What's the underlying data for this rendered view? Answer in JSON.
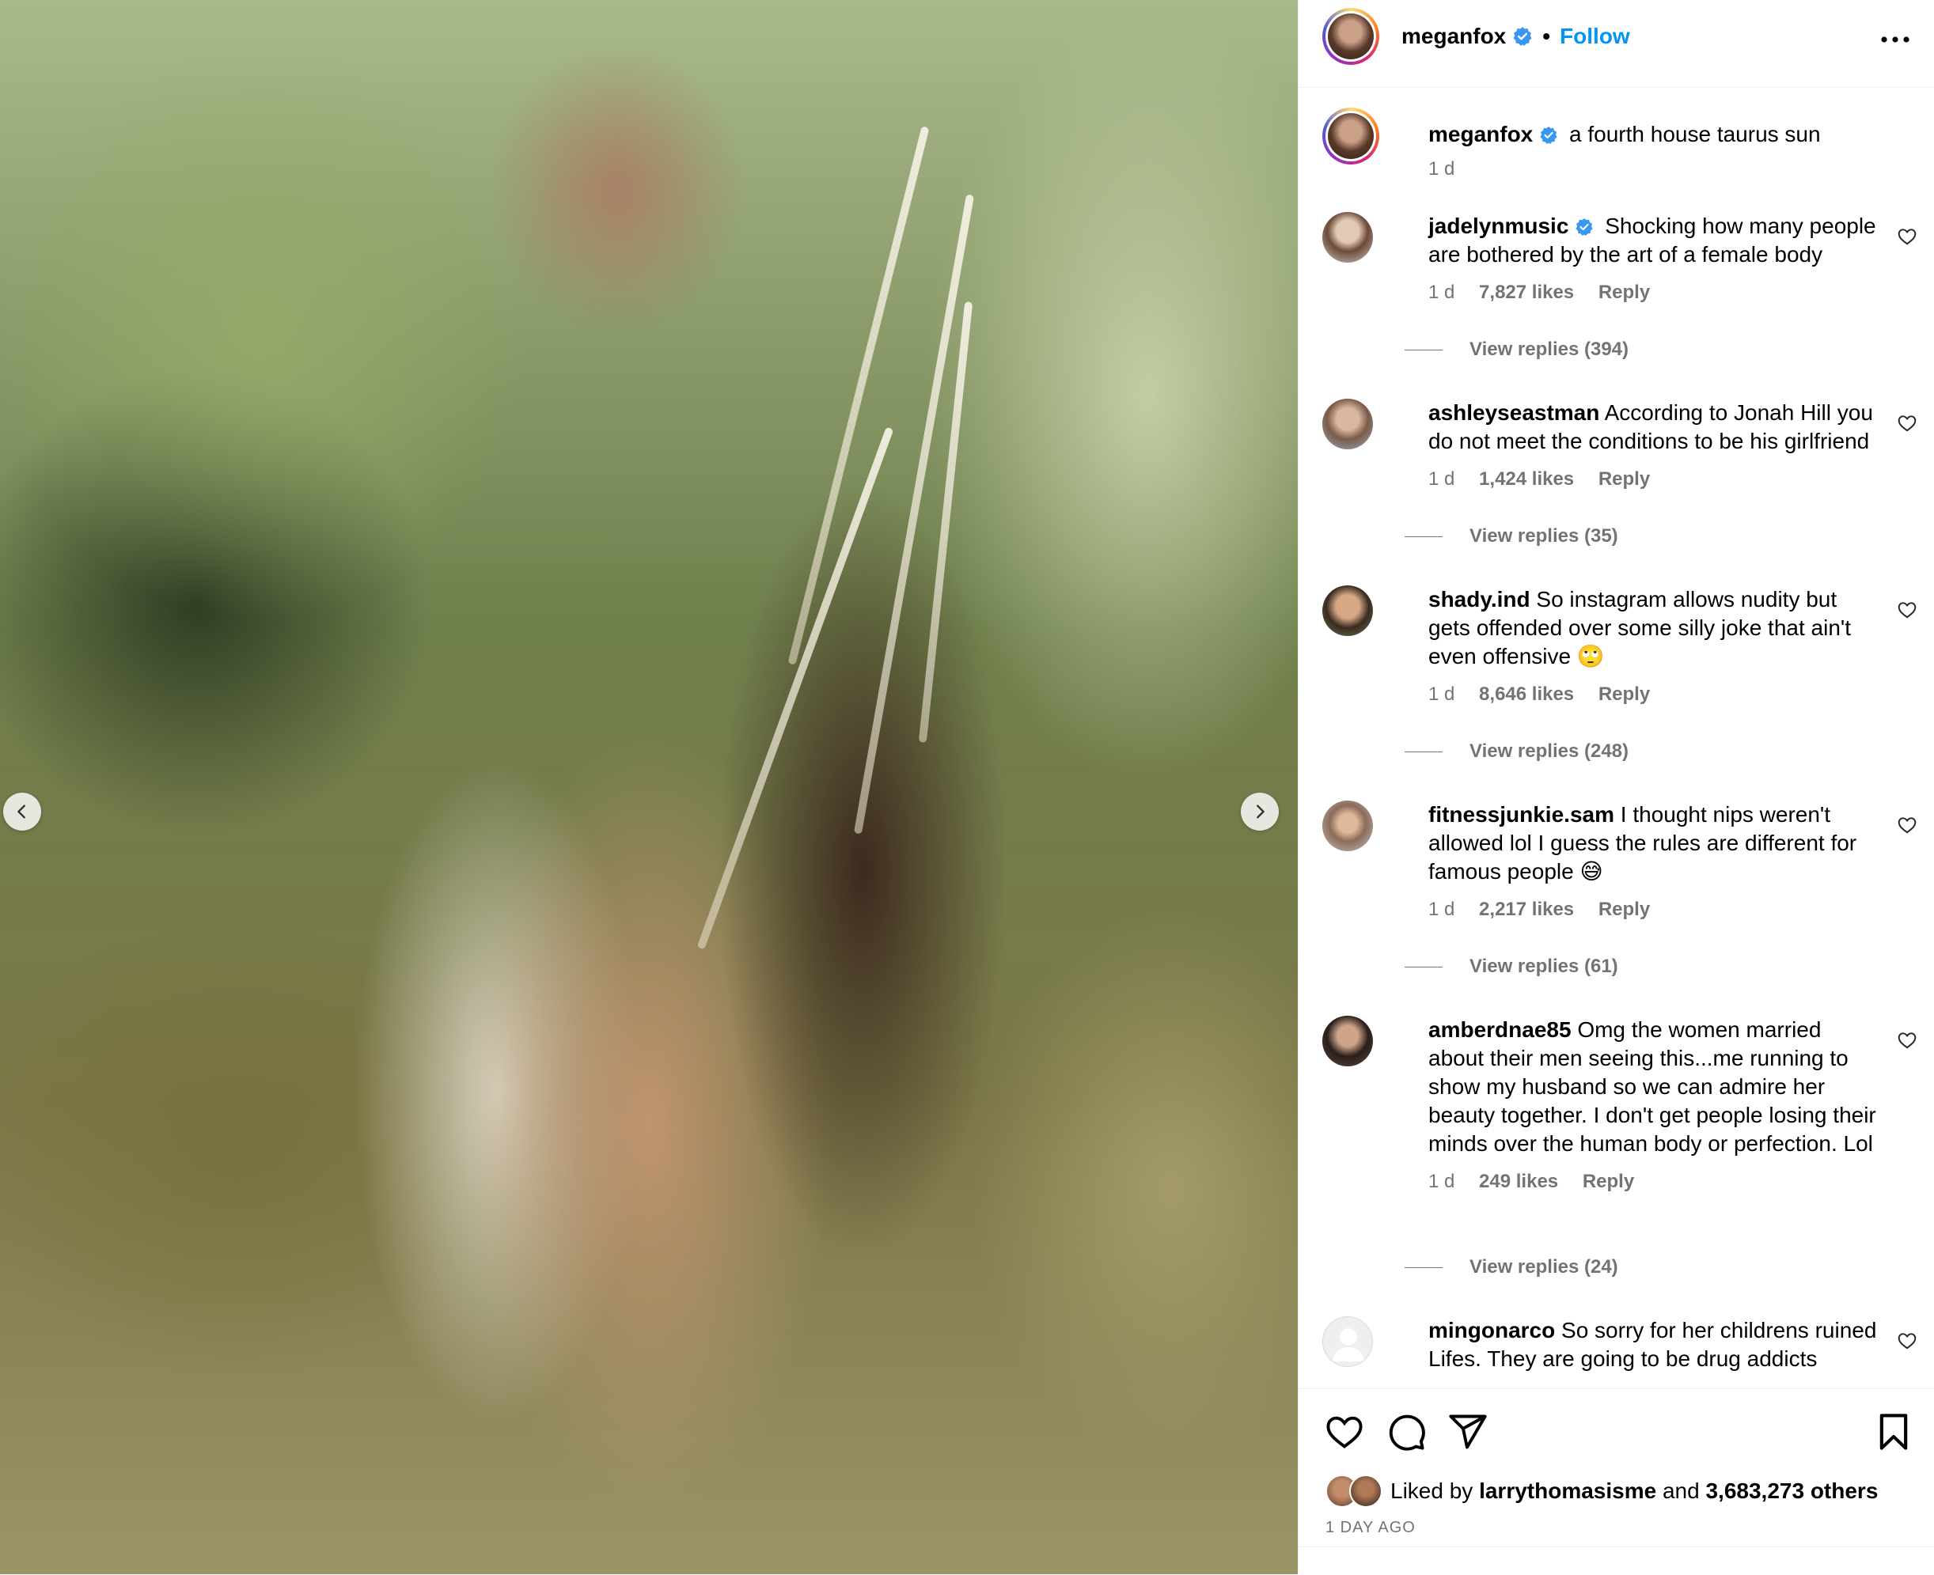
{
  "colors": {
    "accent": "#0095f6",
    "muted": "#737373",
    "verified": "#3897f0",
    "border": "#efefef"
  },
  "post": {
    "username": "meganfox",
    "separator": "•",
    "follow_label": "Follow",
    "more_icon": "more-horizontal-icon",
    "caption": {
      "username": "meganfox",
      "text": "a fourth house taurus sun",
      "time": "1 d"
    }
  },
  "media": {
    "prev_icon": "chevron-left-icon",
    "next_icon": "chevron-right-icon"
  },
  "comments": [
    {
      "username": "jadelynmusic",
      "verified": true,
      "text": "Shocking how many people are bothered by the art of a female body",
      "time": "1 d",
      "likes": "7,827 likes",
      "reply_label": "Reply",
      "view_replies": "View replies (394)"
    },
    {
      "username": "ashleyseastman",
      "verified": false,
      "text": "According to Jonah Hill you do not meet the conditions to be his girlfriend",
      "time": "1 d",
      "likes": "1,424 likes",
      "reply_label": "Reply",
      "view_replies": "View replies (35)"
    },
    {
      "username": "shady.ind",
      "verified": false,
      "text": "So instagram allows nudity but gets offended over some silly joke that ain't even offensive 🙄",
      "time": "1 d",
      "likes": "8,646 likes",
      "reply_label": "Reply",
      "view_replies": "View replies (248)"
    },
    {
      "username": "fitnessjunkie.sam",
      "verified": false,
      "text": "I thought nips weren't allowed lol I guess the rules are different for famous people 😅",
      "time": "1 d",
      "likes": "2,217 likes",
      "reply_label": "Reply",
      "view_replies": "View replies (61)"
    },
    {
      "username": "amberdnae85",
      "verified": false,
      "text": "Omg the women married about their men seeing this...me running to show my husband so we can admire her beauty together. I don't get people losing their minds over the human body or perfection. Lol",
      "time": "1 d",
      "likes": "249 likes",
      "reply_label": "Reply",
      "view_replies": "View replies (24)"
    },
    {
      "username": "mingonarco",
      "verified": false,
      "text": "So sorry for her childrens ruined Lifes. They are going to be drug addicts",
      "time": "",
      "likes": "",
      "reply_label": "",
      "view_replies": ""
    }
  ],
  "actions": {
    "like_icon": "heart-icon",
    "comment_icon": "comment-icon",
    "share_icon": "send-icon",
    "save_icon": "bookmark-icon",
    "liked_by_prefix": "Liked by",
    "liked_by_user": "larrythomasisme",
    "liked_by_and": "and",
    "liked_by_count": "3,683,273 others",
    "date": "1 DAY AGO"
  }
}
